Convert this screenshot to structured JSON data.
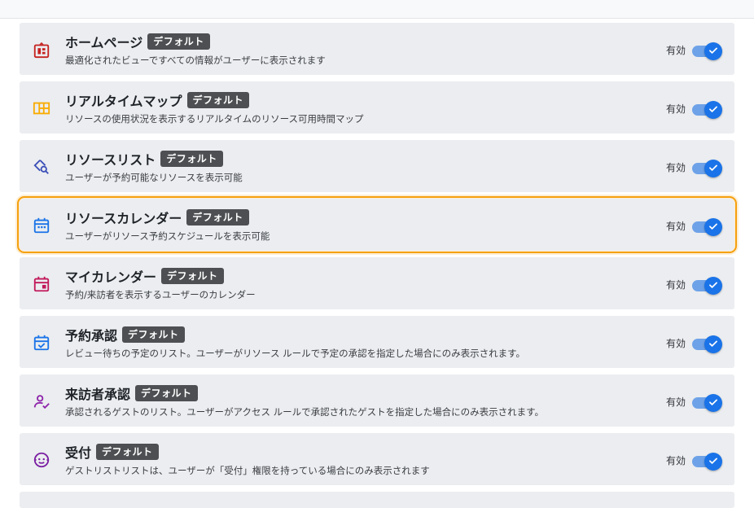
{
  "badge_label": "デフォルト",
  "status_label": "有効",
  "items": [
    {
      "title": "ホームページ",
      "desc": "最適化されたビューですべての情報がユーザーに表示されます",
      "icon": "home-dashboard-icon",
      "color": "#c5221f",
      "enabled": true
    },
    {
      "title": "リアルタイムマップ",
      "desc": "リソースの使用状況を表示するリアルタイムのリソース可用時間マップ",
      "icon": "floor-map-icon",
      "color": "#f9ab00",
      "enabled": true
    },
    {
      "title": "リソースリスト",
      "desc": "ユーザーが予約可能なリソースを表示可能",
      "icon": "resource-search-icon",
      "color": "#3c4fb8",
      "enabled": true
    },
    {
      "title": "リソースカレンダー",
      "desc": "ユーザーがリソース予約スケジュールを表示可能",
      "icon": "calendar-icon",
      "color": "#1a73e8",
      "enabled": true
    },
    {
      "title": "マイカレンダー",
      "desc": "予約/来訪者を表示するユーザーのカレンダー",
      "icon": "event-calendar-icon",
      "color": "#c2185b",
      "enabled": true
    },
    {
      "title": "予約承認",
      "desc": "レビュー待ちの予定のリスト。ユーザーがリソース ルールで予定の承認を指定した場合にのみ表示されます。",
      "icon": "calendar-check-icon",
      "color": "#1a73e8",
      "enabled": true
    },
    {
      "title": "来訪者承認",
      "desc": "承認されるゲストのリスト。ユーザーがアクセス ルールで承認されたゲストを指定した場合にのみ表示されます。",
      "icon": "person-check-icon",
      "color": "#8e24aa",
      "enabled": true
    },
    {
      "title": "受付",
      "desc": "ゲストリストリストは、ユーザーが「受付」権限を持っている場合にのみ表示されます",
      "icon": "reception-face-icon",
      "color": "#7b1fa2",
      "enabled": true
    }
  ]
}
